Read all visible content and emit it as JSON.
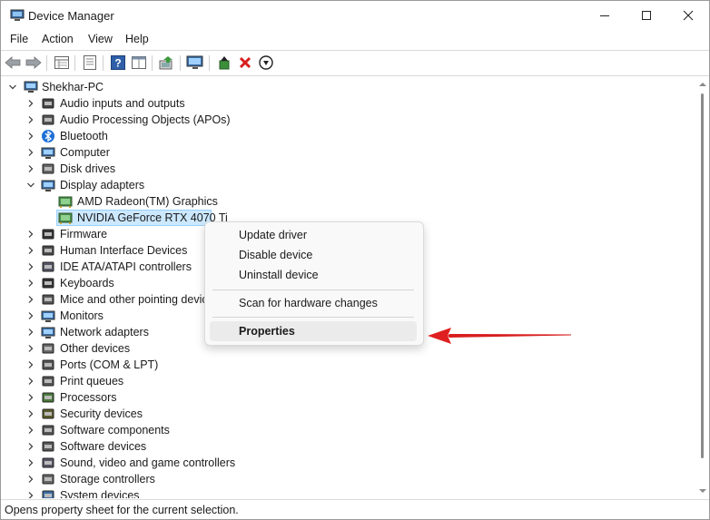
{
  "window": {
    "title": "Device Manager",
    "controls": {
      "minimize": "minimize-icon",
      "maximize": "maximize-icon",
      "close": "close-icon"
    }
  },
  "menu": [
    "File",
    "Action",
    "View",
    "Help"
  ],
  "toolbar": [
    "back-icon",
    "forward-icon",
    "properties-grid-icon",
    "show-hide-console-tree-icon",
    "help-icon",
    "action-pane-icon",
    "update-driver-icon",
    "scan-hardware-icon",
    "enable-device-icon",
    "uninstall-icon",
    "disable-device-icon"
  ],
  "tree": {
    "root": "Shekhar-PC",
    "categories": [
      "Audio inputs and outputs",
      "Audio Processing Objects (APOs)",
      "Bluetooth",
      "Computer",
      "Disk drives",
      "Display adapters",
      "Firmware",
      "Human Interface Devices",
      "IDE ATA/ATAPI controllers",
      "Keyboards",
      "Mice and other pointing devic",
      "Monitors",
      "Network adapters",
      "Other devices",
      "Ports (COM & LPT)",
      "Print queues",
      "Processors",
      "Security devices",
      "Software components",
      "Software devices",
      "Sound, video and game controllers",
      "Storage controllers",
      "System devices"
    ],
    "display_children": [
      "AMD Radeon(TM) Graphics",
      "NVIDIA GeForce RTX 4070 Ti"
    ],
    "selected": "NVIDIA GeForce RTX 4070 Ti"
  },
  "context_menu": {
    "items": [
      "Update driver",
      "Disable device",
      "Uninstall device",
      "Scan for hardware changes",
      "Properties"
    ],
    "highlighted": "Properties"
  },
  "annotation": {
    "arrow_color": "#e02020"
  },
  "status": "Opens property sheet for the current selection.",
  "colors": {
    "selection": "#cce8ff",
    "menu_highlight": "#ebebeb",
    "accent": "#0067c0"
  }
}
